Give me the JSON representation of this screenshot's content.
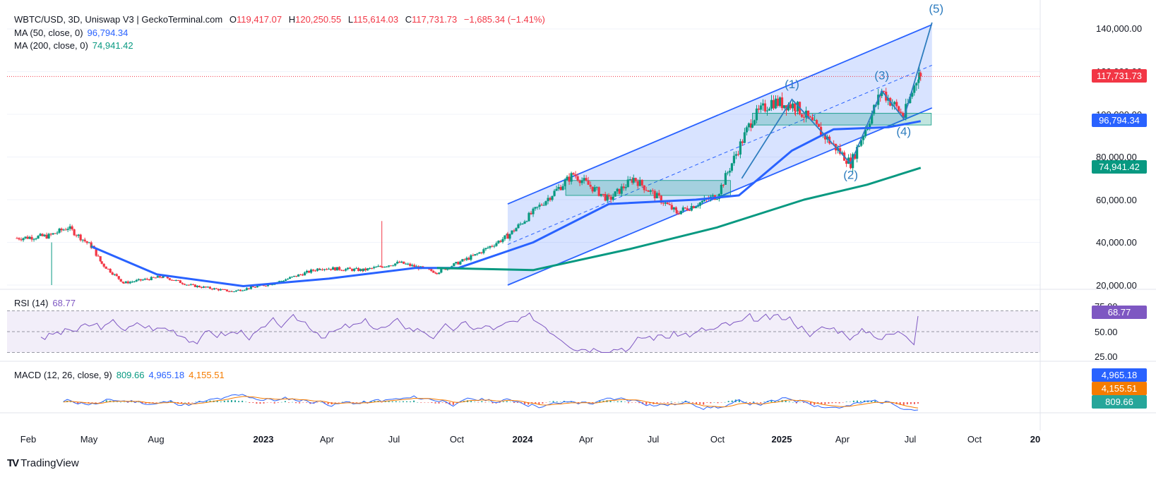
{
  "header": {
    "symbol": "WBTC/USD, 3D, Uniswap V3 | GeckoTerminal.com",
    "open_label": "O",
    "open": "119,417.07",
    "high_label": "H",
    "high": "120,250.55",
    "low_label": "L",
    "low": "115,614.03",
    "close_label": "C",
    "close": "117,731.73",
    "change": "−1,685.34 (−1.41%)"
  },
  "ma50": {
    "label": "MA (50, close, 0)",
    "value": "96,794.34",
    "color": "#2962ff"
  },
  "ma200": {
    "label": "MA (200, close, 0)",
    "value": "74,941.42",
    "color": "#089981"
  },
  "rsi": {
    "label": "RSI (14)",
    "value": "68.77",
    "color": "#7e57c2"
  },
  "macd": {
    "label": "MACD (12, 26, close, 9)",
    "histogram": "809.66",
    "macd": "4,965.18",
    "signal": "4,155.51",
    "hist_color": "#089981",
    "macd_color": "#2962ff",
    "signal_color": "#f57c00"
  },
  "price_axis": [
    "140,000.00",
    "120,000.00",
    "100,000.00",
    "80,000.00",
    "60,000.00",
    "40,000.00",
    "20,000.00"
  ],
  "rsi_axis": [
    "75.00",
    "50.00",
    "25.00"
  ],
  "price_tags": {
    "close": "117,731.73",
    "ma50": "96,794.34",
    "ma200": "74,941.42",
    "rsi": "68.77",
    "macd": "4,965.18",
    "signal": "4,155.51",
    "hist": "809.66"
  },
  "time_axis": [
    {
      "label": "Feb",
      "bold": false
    },
    {
      "label": "May",
      "bold": false
    },
    {
      "label": "Aug",
      "bold": false
    },
    {
      "label": "2023",
      "bold": true
    },
    {
      "label": "Apr",
      "bold": false
    },
    {
      "label": "Jul",
      "bold": false
    },
    {
      "label": "Oct",
      "bold": false
    },
    {
      "label": "2024",
      "bold": true
    },
    {
      "label": "Apr",
      "bold": false
    },
    {
      "label": "Jul",
      "bold": false
    },
    {
      "label": "Oct",
      "bold": false
    },
    {
      "label": "2025",
      "bold": true
    },
    {
      "label": "Apr",
      "bold": false
    },
    {
      "label": "Jul",
      "bold": false
    },
    {
      "label": "Oct",
      "bold": false
    },
    {
      "label": "20",
      "bold": true
    }
  ],
  "wave_labels": [
    "(1)",
    "(2)",
    "(3)",
    "(4)",
    "(5)"
  ],
  "brand": "TradingView",
  "colors": {
    "up": "#089981",
    "down": "#f23645",
    "channel": "#2962ff",
    "grid": "#f0f3fa"
  },
  "chart_data": {
    "type": "candlestick",
    "title": "WBTC/USD, 3D, Uniswap V3",
    "ylim": [
      20000,
      140000
    ],
    "y_scale": "linear",
    "price_path": [
      {
        "date": "2022-01-15",
        "close": 42000
      },
      {
        "date": "2022-03-01",
        "close": 43000
      },
      {
        "date": "2022-03-28",
        "close": 47000
      },
      {
        "date": "2022-05-01",
        "close": 38000
      },
      {
        "date": "2022-05-15",
        "close": 30000
      },
      {
        "date": "2022-06-15",
        "close": 21000
      },
      {
        "date": "2022-08-10",
        "close": 24000
      },
      {
        "date": "2022-09-15",
        "close": 20000
      },
      {
        "date": "2022-11-15",
        "close": 17000
      },
      {
        "date": "2023-01-15",
        "close": 21000
      },
      {
        "date": "2023-03-20",
        "close": 28000
      },
      {
        "date": "2023-05-20",
        "close": 27000
      },
      {
        "date": "2023-07-10",
        "close": 30500
      },
      {
        "date": "2023-09-01",
        "close": 26000
      },
      {
        "date": "2023-10-25",
        "close": 34000
      },
      {
        "date": "2023-12-10",
        "close": 43000
      },
      {
        "date": "2024-03-12",
        "close": 72000
      },
      {
        "date": "2024-05-01",
        "close": 60000
      },
      {
        "date": "2024-06-05",
        "close": 70000
      },
      {
        "date": "2024-08-05",
        "close": 54000
      },
      {
        "date": "2024-10-01",
        "close": 62000
      },
      {
        "date": "2024-11-20",
        "close": 98000
      },
      {
        "date": "2024-12-17",
        "close": 106000
      },
      {
        "date": "2025-01-20",
        "close": 104000
      },
      {
        "date": "2025-04-08",
        "close": 77000
      },
      {
        "date": "2025-05-22",
        "close": 111000
      },
      {
        "date": "2025-06-22",
        "close": 99000
      },
      {
        "date": "2025-07-14",
        "close": 120000
      },
      {
        "date": "2025-07-16",
        "close": 117731.73
      }
    ],
    "series": [
      {
        "name": "MA (50, close, 0)",
        "last": 96794.34
      },
      {
        "name": "MA (200, close, 0)",
        "last": 74941.42
      }
    ],
    "ma50_path": [
      {
        "date": "2022-05-01",
        "value": 38000
      },
      {
        "date": "2022-08-01",
        "value": 25000
      },
      {
        "date": "2022-12-01",
        "value": 19500
      },
      {
        "date": "2023-04-01",
        "value": 23000
      },
      {
        "date": "2023-08-01",
        "value": 28000
      },
      {
        "date": "2023-10-01",
        "value": 28000
      },
      {
        "date": "2024-01-15",
        "value": 40000
      },
      {
        "date": "2024-05-01",
        "value": 58000
      },
      {
        "date": "2024-09-01",
        "value": 60000
      },
      {
        "date": "2024-11-01",
        "value": 62000
      },
      {
        "date": "2025-01-15",
        "value": 83000
      },
      {
        "date": "2025-03-15",
        "value": 93000
      },
      {
        "date": "2025-06-01",
        "value": 94000
      },
      {
        "date": "2025-07-16",
        "value": 96794.34
      }
    ],
    "ma200_path": [
      {
        "date": "2023-09-01",
        "value": 28000
      },
      {
        "date": "2024-01-15",
        "value": 27000
      },
      {
        "date": "2024-06-01",
        "value": 37000
      },
      {
        "date": "2024-10-01",
        "value": 47000
      },
      {
        "date": "2025-02-01",
        "value": 60000
      },
      {
        "date": "2025-05-01",
        "value": 67000
      },
      {
        "date": "2025-07-16",
        "value": 74941.42
      }
    ],
    "channel": {
      "upper": [
        {
          "date": "2023-12-10",
          "value": 58000
        },
        {
          "date": "2025-08-01",
          "value": 142000
        }
      ],
      "lower": [
        {
          "date": "2023-12-10",
          "value": 20000
        },
        {
          "date": "2025-08-01",
          "value": 103000
        }
      ],
      "mid": [
        {
          "date": "2023-12-10",
          "value": 39000
        },
        {
          "date": "2025-08-01",
          "value": 123000
        }
      ]
    },
    "zones": [
      {
        "from": "2024-03-01",
        "to": "2024-10-20",
        "low": 62000,
        "high": 69000
      },
      {
        "from": "2024-11-20",
        "to": "2025-07-31",
        "low": 95000,
        "high": 100500
      }
    ],
    "waves": [
      {
        "label": "(1)",
        "date": "2025-01-15",
        "value": 107000
      },
      {
        "label": "(2)",
        "date": "2025-04-08",
        "value": 77000
      },
      {
        "label": "(3)",
        "date": "2025-05-22",
        "value": 111000
      },
      {
        "label": "(4)",
        "date": "2025-06-22",
        "value": 98000
      },
      {
        "label": "(5)",
        "date": "2025-08-01",
        "value": 143000
      }
    ],
    "rsi": {
      "ylim": [
        20,
        85
      ],
      "levels": [
        75,
        50,
        25
      ],
      "last": 68.77
    },
    "macd": {
      "macd": 4965.18,
      "signal": 4155.51,
      "histogram": 809.66
    }
  }
}
